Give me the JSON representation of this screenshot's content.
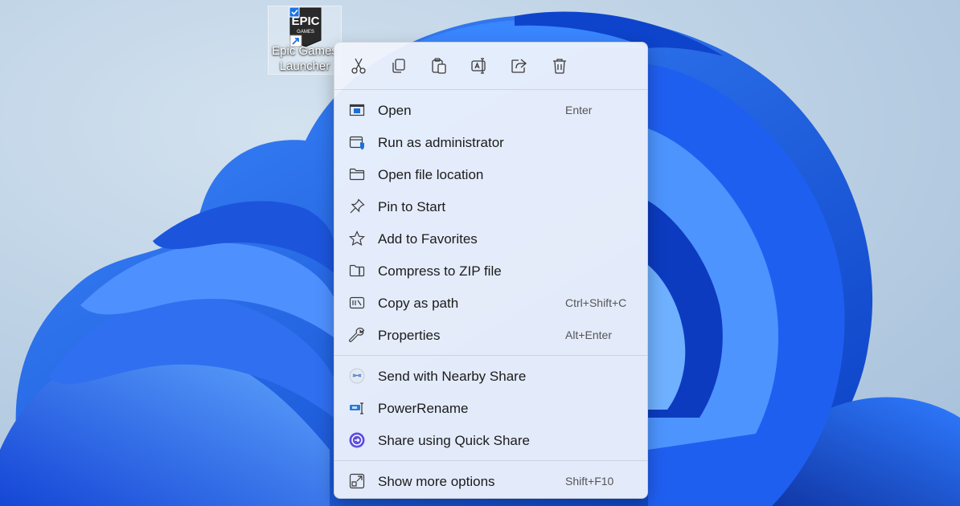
{
  "desktop": {
    "icon": {
      "label_line1": "Epic Games",
      "label_line2": "Launcher",
      "logo_text_top": "EPIC",
      "logo_text_bottom": "GAMES",
      "name": "epic-games-launcher"
    }
  },
  "context_menu": {
    "toolbar": [
      {
        "name": "cut",
        "icon": "scissors-icon"
      },
      {
        "name": "copy",
        "icon": "copy-icon"
      },
      {
        "name": "paste",
        "icon": "paste-icon"
      },
      {
        "name": "rename",
        "icon": "rename-icon"
      },
      {
        "name": "share",
        "icon": "share-icon"
      },
      {
        "name": "delete",
        "icon": "trash-icon"
      }
    ],
    "items": [
      {
        "label": "Open",
        "shortcut": "Enter",
        "icon": "open-window-icon"
      },
      {
        "label": "Run as administrator",
        "shortcut": "",
        "icon": "shield-window-icon"
      },
      {
        "label": "Open file location",
        "shortcut": "",
        "icon": "folder-icon"
      },
      {
        "label": "Pin to Start",
        "shortcut": "",
        "icon": "pin-icon"
      },
      {
        "label": "Add to Favorites",
        "shortcut": "",
        "icon": "star-icon"
      },
      {
        "label": "Compress to ZIP file",
        "shortcut": "",
        "icon": "zip-folder-icon"
      },
      {
        "label": "Copy as path",
        "shortcut": "Ctrl+Shift+C",
        "icon": "path-icon"
      },
      {
        "label": "Properties",
        "shortcut": "Alt+Enter",
        "icon": "wrench-icon"
      },
      {
        "label": "Send with Nearby Share",
        "shortcut": "",
        "icon": "nearby-share-icon"
      },
      {
        "label": "PowerRename",
        "shortcut": "",
        "icon": "powerrename-icon"
      },
      {
        "label": "Share using Quick Share",
        "shortcut": "",
        "icon": "quick-share-icon"
      },
      {
        "label": "Show more options",
        "shortcut": "Shift+F10",
        "icon": "more-options-icon"
      }
    ]
  },
  "colors": {
    "accent": "#0067c0",
    "wallpaper_bg": "#bcd2e6",
    "bloom_blue": "#1f63e8"
  }
}
